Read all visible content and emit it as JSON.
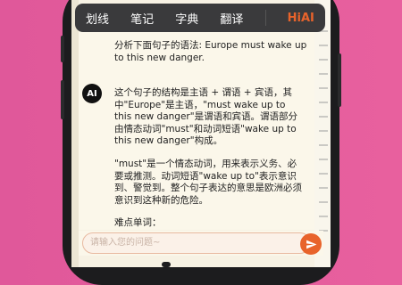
{
  "toolbar": {
    "tabs": [
      {
        "label": "划线",
        "active": false
      },
      {
        "label": "笔记",
        "active": false
      },
      {
        "label": "字典",
        "active": false
      },
      {
        "label": "翻译",
        "active": false
      },
      {
        "label": "HiAI",
        "active": true
      }
    ]
  },
  "chat": {
    "question": "分析下面句子的语法: Europe must wake up to this new danger.",
    "ai_label": "AI",
    "answer_paragraphs": [
      "这个句子的结构是主语 + 谓语 + 宾语，其中\"Europe\"是主语，\"must wake up to this new danger\"是谓语和宾语。谓语部分由情态动词\"must\"和动词短语\"wake up to this new danger\"构成。",
      "\"must\"是一个情态动词，用来表示义务、必要或推测。动词短语\"wake up to\"表示意识到、警觉到。整个句子表达的意思是欧洲必须意识到这种新的危险。",
      "难点单词："
    ]
  },
  "input": {
    "placeholder": "请输入您的问题~"
  },
  "colors": {
    "background": "#e0589a",
    "accent": "#e8632b",
    "toolbar": "#3a3a3c",
    "content_bg": "#fbf7ea"
  },
  "icons": {
    "send": "send-icon"
  }
}
